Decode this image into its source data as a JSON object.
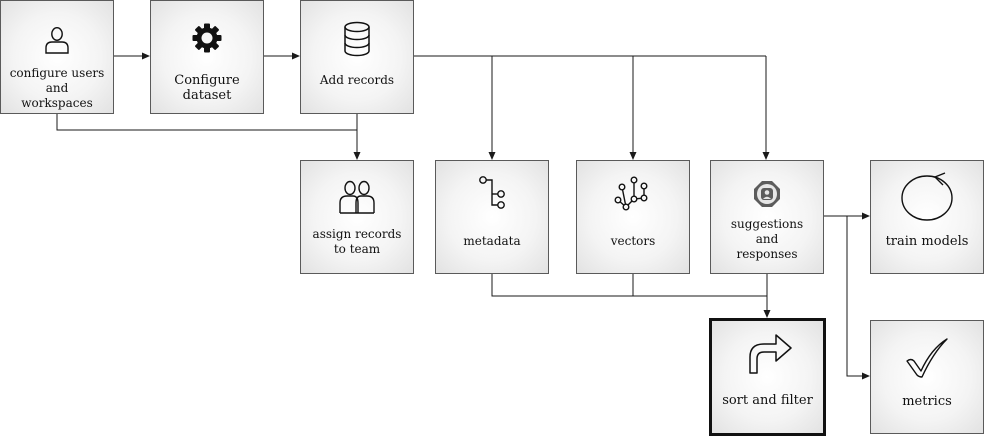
{
  "nodes": {
    "configure_users": {
      "label": "configure users and\nworkspaces",
      "icon": "user-icon"
    },
    "configure_dataset": {
      "label": "Configure dataset",
      "icon": "gear-icon"
    },
    "add_records": {
      "label": "Add records",
      "icon": "database-icon"
    },
    "assign_records": {
      "label": "assign records\nto team",
      "icon": "team-icon"
    },
    "metadata": {
      "label": "metadata",
      "icon": "branch-icon"
    },
    "vectors": {
      "label": "vectors",
      "icon": "network-icon"
    },
    "suggestions": {
      "label": "suggestions\nand\nresponses",
      "icon": "robot-badge-icon"
    },
    "train_models": {
      "label": "train models",
      "icon": "cycle-icon"
    },
    "sort_filter": {
      "label": "sort and filter",
      "icon": "curved-arrow-icon"
    },
    "metrics": {
      "label": "metrics",
      "icon": "checkmark-icon"
    }
  },
  "colors": {
    "border": "#5a5a5a",
    "highlight_border": "#111111",
    "connector": "#1a1a1a",
    "fill_center": "#ffffff",
    "fill_edge": "#e2e2e2"
  }
}
